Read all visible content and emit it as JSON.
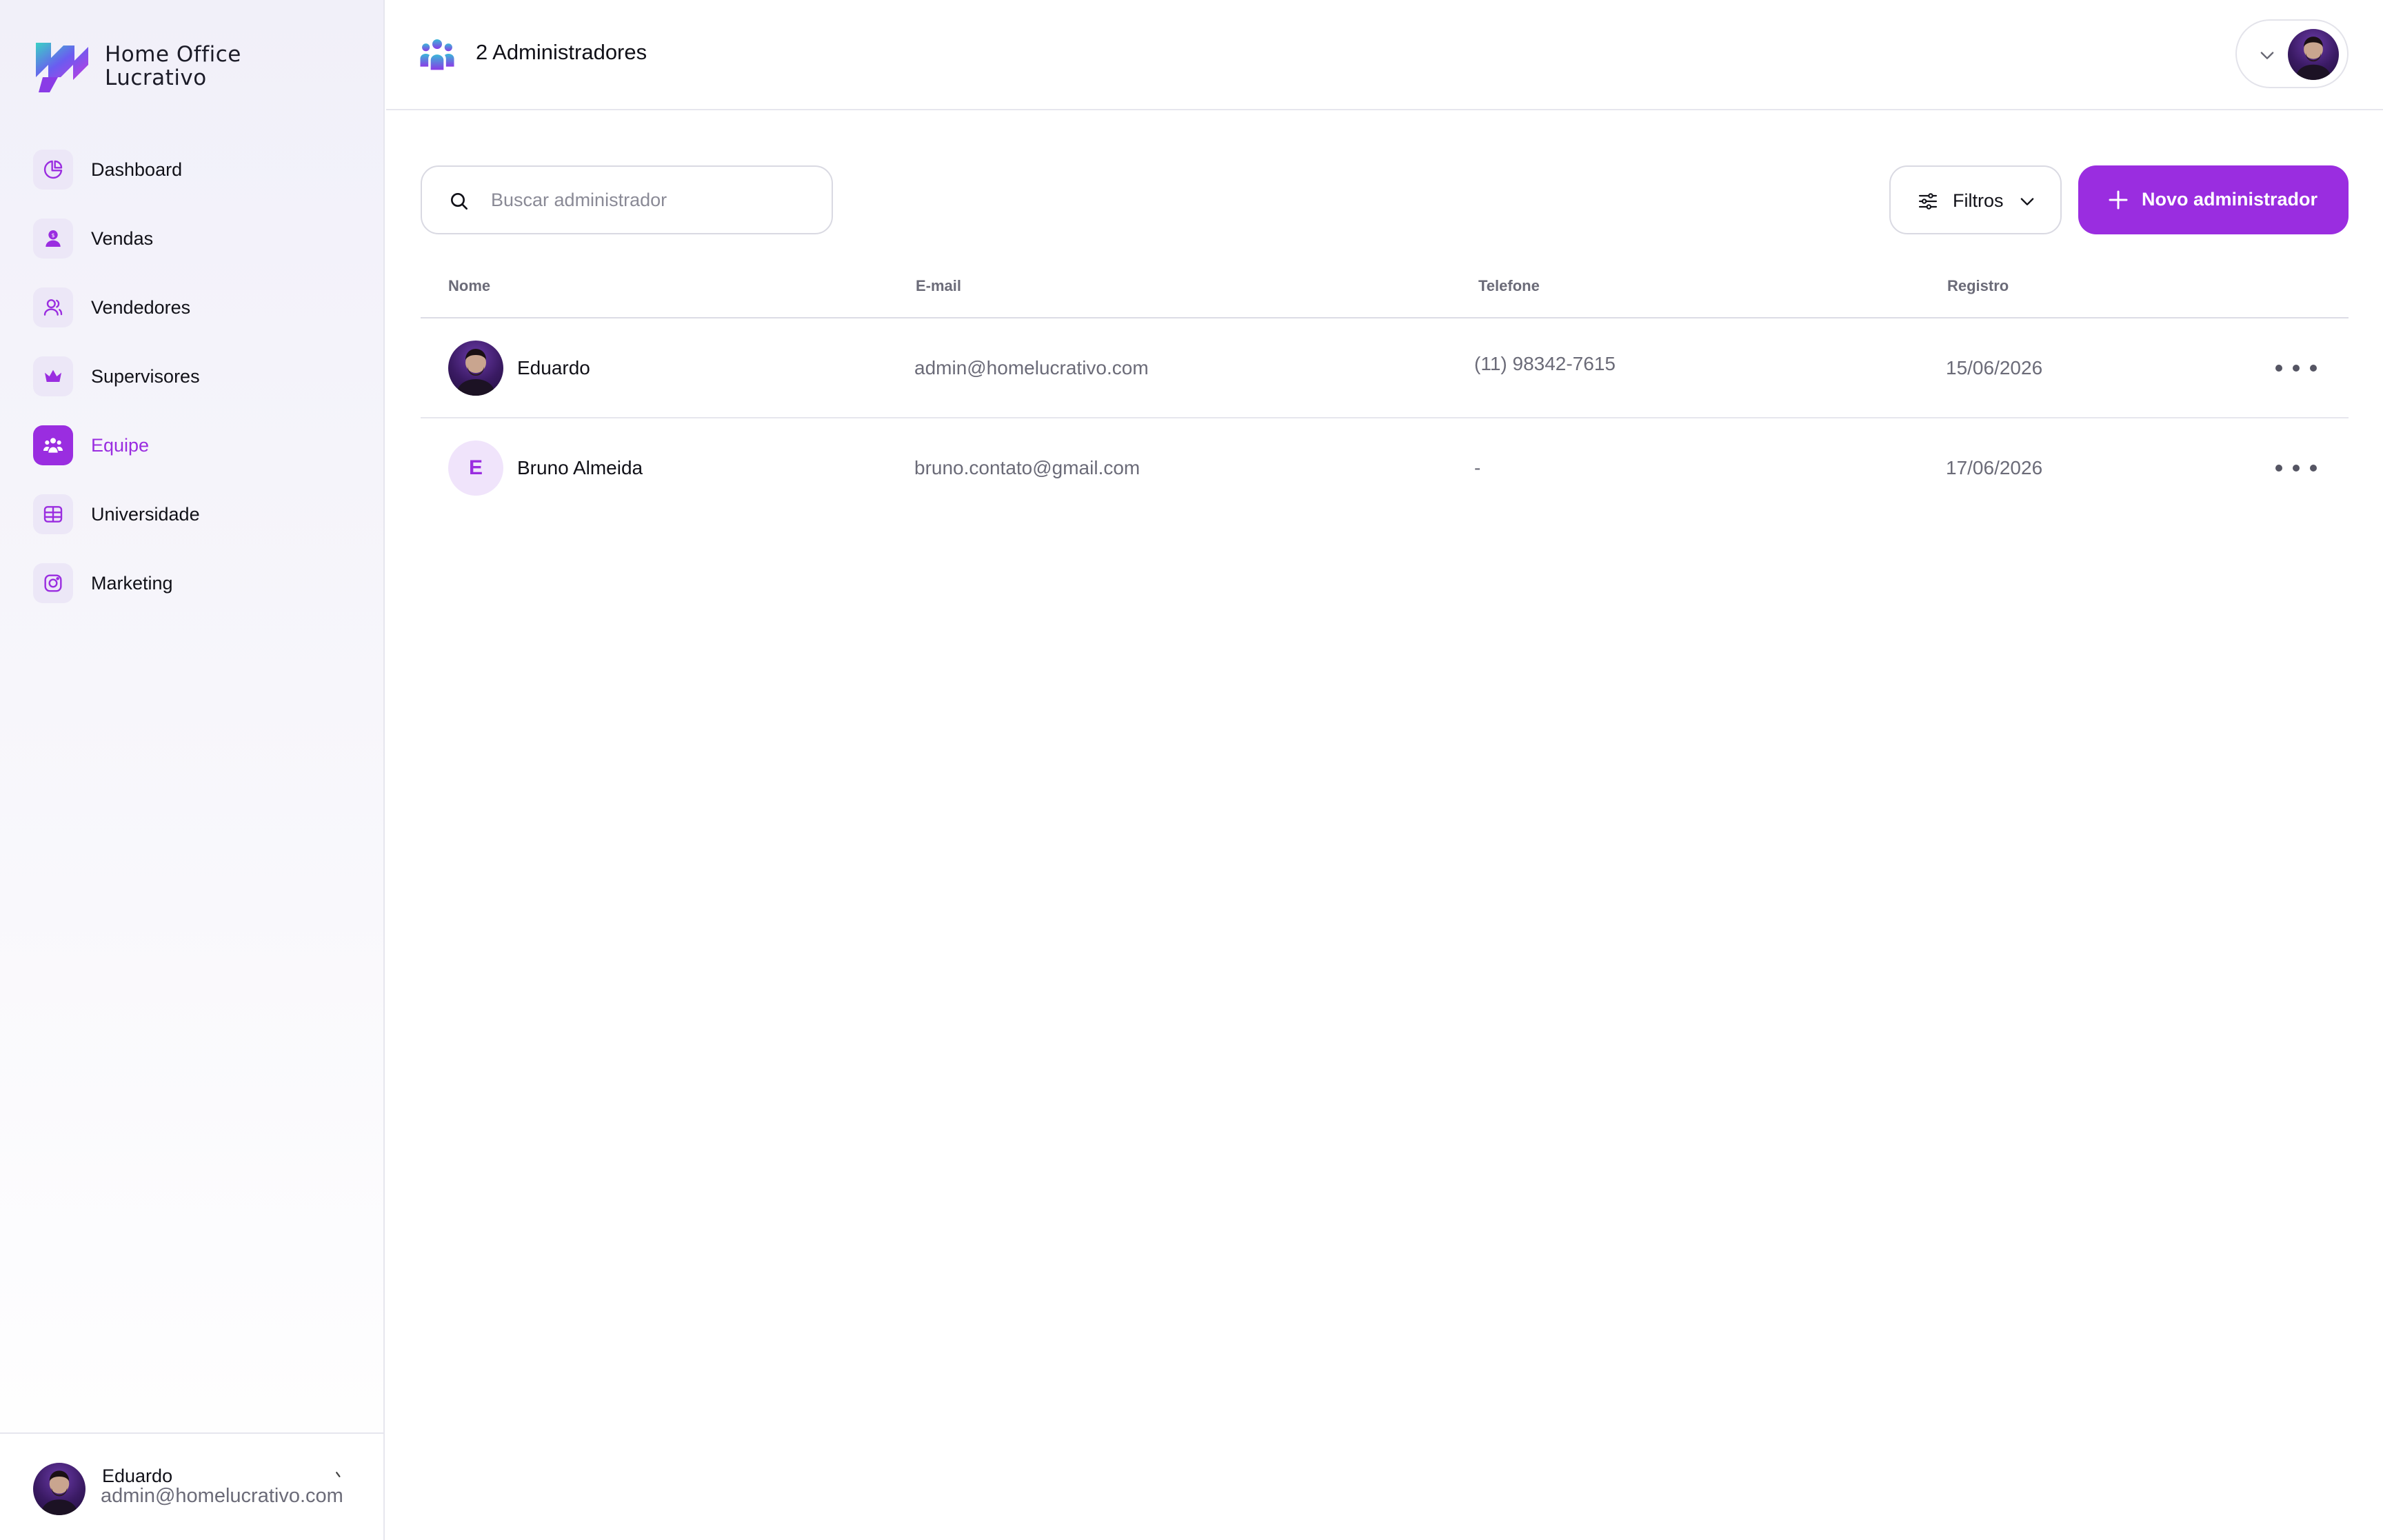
{
  "brand": {
    "line1": "Home Office",
    "line2": "Lucrativo"
  },
  "colors": {
    "accent": "#9a2de0",
    "accent_soft": "#ece7f7",
    "text": "#111118",
    "muted": "#6b6b78",
    "border": "#e6e6ee"
  },
  "sidebar": {
    "items": [
      {
        "label": "Dashboard",
        "icon": "pie-chart-icon"
      },
      {
        "label": "Vendas",
        "icon": "sales-person-icon"
      },
      {
        "label": "Vendedores",
        "icon": "users-icon"
      },
      {
        "label": "Supervisores",
        "icon": "crown-icon"
      },
      {
        "label": "Equipe",
        "icon": "team-icon",
        "active": true
      },
      {
        "label": "Universidade",
        "icon": "grid-book-icon"
      },
      {
        "label": "Marketing",
        "icon": "instagram-icon"
      }
    ],
    "user": {
      "name": "Eduardo",
      "email": "admin@homelucrativo.com",
      "chevron": "`"
    }
  },
  "header": {
    "title": "2 Administradores",
    "icon": "team-icon"
  },
  "toolbar": {
    "search_placeholder": "Buscar administrador",
    "search_value": "",
    "filters_label": "Filtros",
    "new_label": "Novo administrador"
  },
  "table": {
    "columns": [
      "Nome",
      "E-mail",
      "Telefone",
      "Registro"
    ],
    "rows": [
      {
        "name": "Eduardo",
        "avatar": "photo",
        "email": "admin@homelucrativo.com",
        "phone": "(11) 98342-7615",
        "date": "15/06/2026"
      },
      {
        "name": "Bruno Almeida",
        "avatar": "E",
        "email": "bruno.contato@gmail.com",
        "phone": "-",
        "date": "17/06/2026"
      }
    ]
  }
}
